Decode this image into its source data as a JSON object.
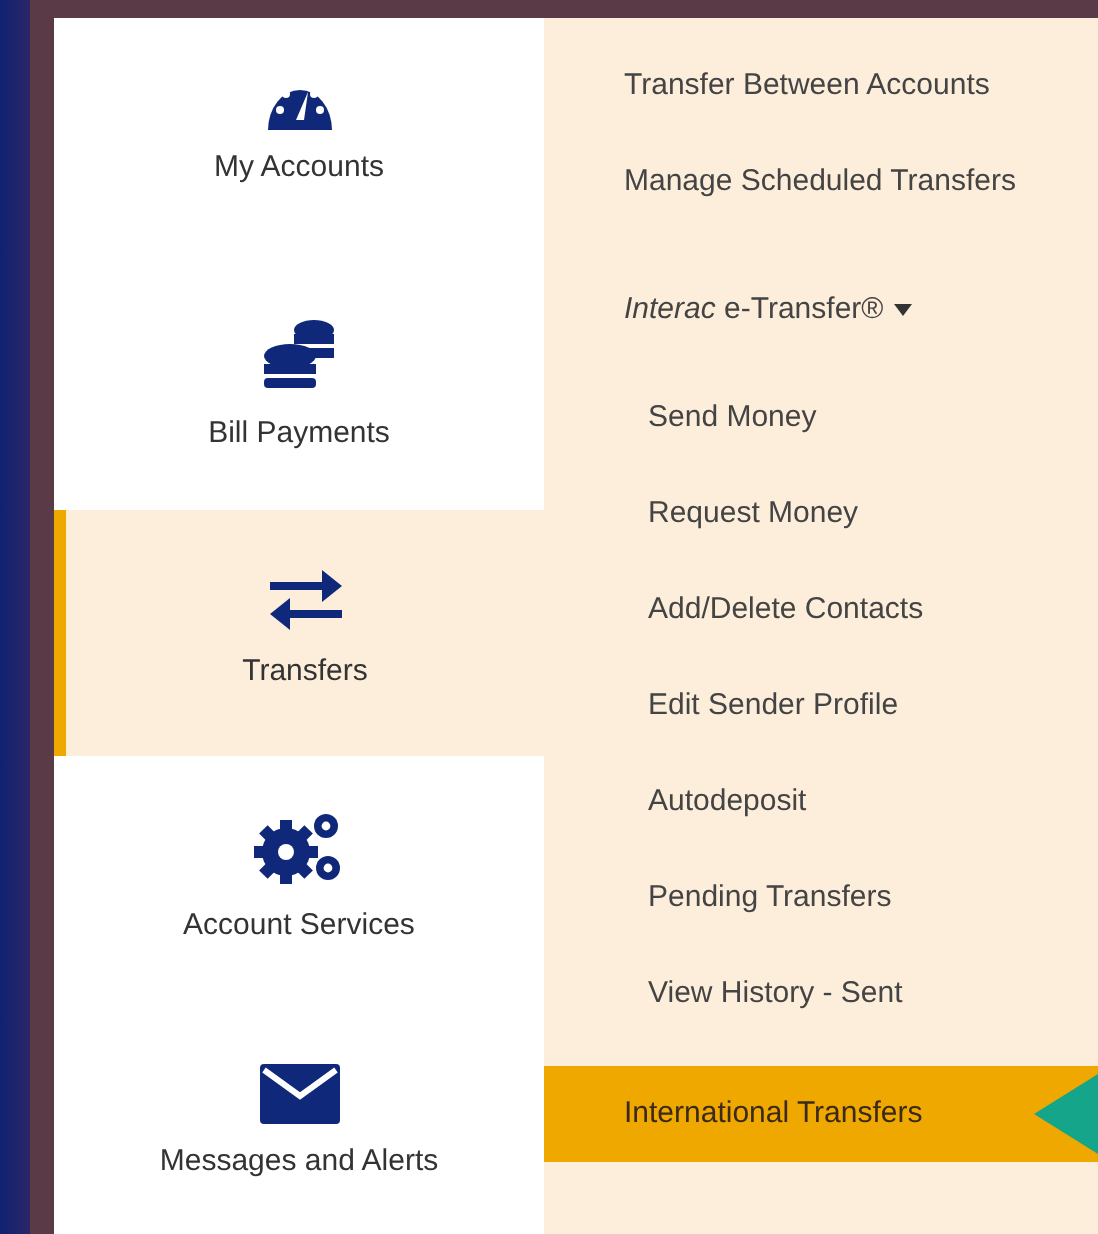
{
  "sidebar": {
    "items": [
      {
        "label": "My Accounts",
        "kind": "gauge",
        "selected": false
      },
      {
        "label": "Bill Payments",
        "kind": "coins",
        "selected": false
      },
      {
        "label": "Transfers",
        "kind": "arrows",
        "selected": true
      },
      {
        "label": "Account Services",
        "kind": "gears",
        "selected": false
      },
      {
        "label": "Messages and Alerts",
        "kind": "envelope",
        "selected": false
      }
    ]
  },
  "submenu": {
    "items": [
      {
        "kind": "link",
        "label": "Transfer Between Accounts",
        "selected": false
      },
      {
        "kind": "link",
        "label": "Manage Scheduled Transfers",
        "selected": false
      },
      {
        "kind": "group",
        "label": "*Interac* e-Transfer®",
        "expanded": true,
        "children": [
          {
            "label": "Send Money",
            "selected": false
          },
          {
            "label": "Request Money",
            "selected": false
          },
          {
            "label": "Add/Delete Contacts",
            "selected": false
          },
          {
            "label": "Edit Sender Profile",
            "selected": false
          },
          {
            "label": "Autodeposit",
            "selected": false
          },
          {
            "label": "Pending Transfers",
            "selected": false
          },
          {
            "label": "View History - Sent",
            "selected": false
          }
        ]
      },
      {
        "kind": "link",
        "label": "International Transfers",
        "selected": true
      }
    ]
  }
}
